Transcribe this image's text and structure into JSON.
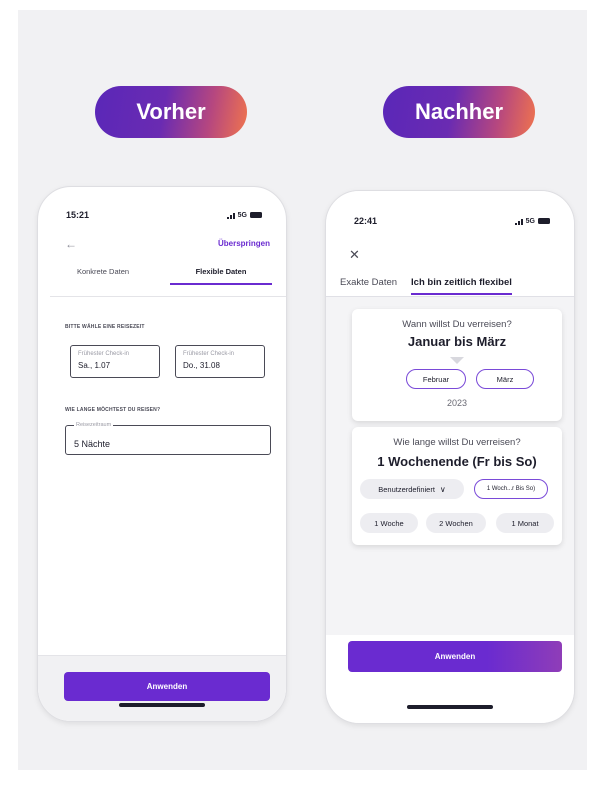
{
  "labels": {
    "before": "Vorher",
    "after": "Nachher"
  },
  "before": {
    "status": {
      "time": "15:21",
      "network": "5G"
    },
    "back_icon": "arrow-left-icon",
    "skip": "Überspringen",
    "tabs": [
      "Konkrete Daten",
      "Flexible Daten"
    ],
    "active_tab": 1,
    "section1": "BITTE WÄHLE EINE REISEZEIT",
    "checkin_placeholder": "Frühester Check-in",
    "checkin_value": "Sa., 1.07",
    "checkout_placeholder": "Frühester Check-in",
    "checkout_value": "Do., 31.08",
    "section2": "WIE LANGE MÖCHTEST DU REISEN?",
    "duration_legend": "Reisezeitraum",
    "duration_value": "5 Nächte",
    "apply": "Anwenden"
  },
  "after": {
    "status": {
      "time": "22:41",
      "network": "5G"
    },
    "close_icon": "close-icon",
    "tabs": [
      "Exakte Daten",
      "Ich bin zeitlich flexibel"
    ],
    "active_tab": 1,
    "when": {
      "question": "Wann willst Du verreisen?",
      "answer": "Januar  bis März",
      "months": [
        "Februar",
        "März"
      ],
      "year": "2023"
    },
    "duration": {
      "question": "Wie lange willst Du verreisen?",
      "answer": "1 Wochenende (Fr bis So)",
      "dropdown": "Benutzerdefiniert",
      "selected_chip": "1 Woch...r Bis So)",
      "options": [
        "1 Woche",
        "2 Wochen",
        "1 Monat"
      ]
    },
    "apply": "Anwenden"
  },
  "colors": {
    "accent": "#6a2bd0",
    "pill_start": "#5a27b8",
    "pill_end": "#f0744d"
  }
}
